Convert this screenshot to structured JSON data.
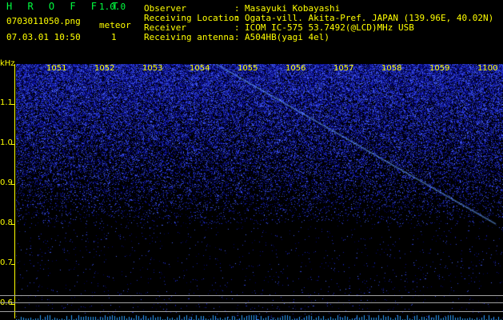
{
  "app": {
    "name": "H R O F F T",
    "version": "1.0.0"
  },
  "file": {
    "name": "0703011050.png",
    "datetime": "07.03.01 10:50"
  },
  "meteor": {
    "label": "meteor",
    "count": "1"
  },
  "info": [
    {
      "label": "Observer",
      "value": "Masayuki Kobayashi"
    },
    {
      "label": "Receiving Location",
      "value": "Ogata-vill. Akita-Pref. JAPAN (139.96E, 40.02N)"
    },
    {
      "label": "Receiver",
      "value": "ICOM IC-575 53.7492(@LCD)MHz USB"
    },
    {
      "label": "Receiving antenna",
      "value": "A504HB(yagi 4el)"
    }
  ],
  "info_separator": ":",
  "spectrogram": {
    "y_unit": "kHz",
    "y_ticks": [
      "1.1",
      "1.0",
      "0.9",
      "0.8",
      "0.7",
      "0.6"
    ],
    "x_ticks": [
      "1051",
      "1052",
      "1053",
      "1054",
      "1055",
      "1056",
      "1057",
      "1058",
      "1059",
      "1100"
    ],
    "colors": {
      "noise": "#1a2cff",
      "signal": "#6fe0ff",
      "label": "#ffff00",
      "header": "#00ff40"
    }
  }
}
